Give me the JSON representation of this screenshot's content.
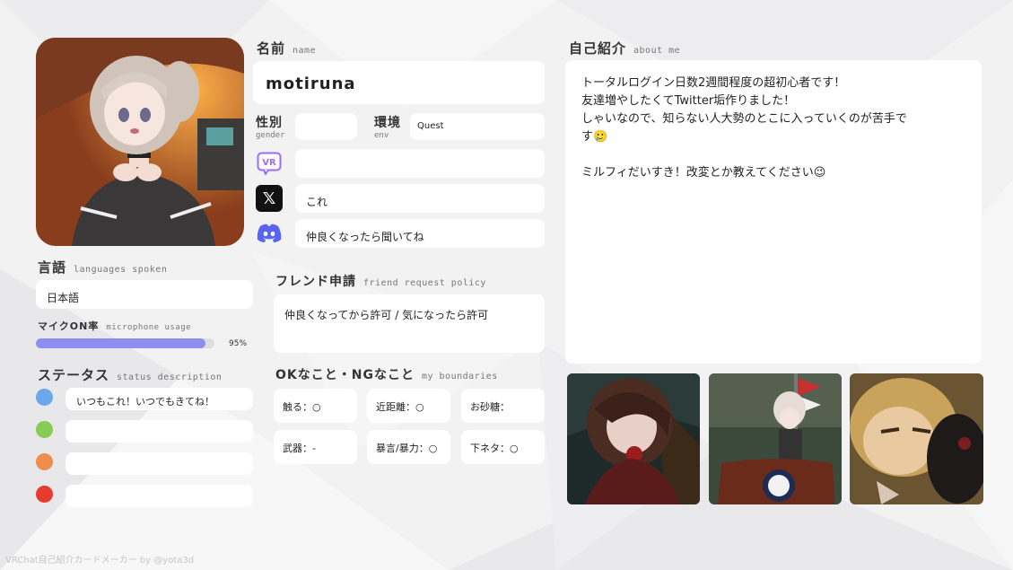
{
  "name": {
    "label": "名前",
    "sub": "name",
    "value": "motiruna"
  },
  "gender": {
    "label": "性別",
    "sub": "gender",
    "value": ""
  },
  "env": {
    "label": "環境",
    "sub": "env",
    "value": "Quest"
  },
  "vr": {
    "icon": "vr-icon",
    "icon_text": "VR",
    "value": ""
  },
  "x": {
    "icon": "x-icon",
    "icon_text": "𝕏",
    "value": "これ"
  },
  "discord": {
    "icon": "discord-icon",
    "value": "仲良くなったら聞いてね"
  },
  "languages": {
    "label": "言語",
    "sub": "languages spoken",
    "value": "日本語"
  },
  "mic": {
    "label": "マイクON率",
    "sub": "microphone usage",
    "percent": 95,
    "percent_text": "95%"
  },
  "status": {
    "label": "ステータス",
    "sub": "status description",
    "items": [
      {
        "color": "#6aa8ea",
        "text": "いつもこれ！いつでもきてね！"
      },
      {
        "color": "#86cc55",
        "text": ""
      },
      {
        "color": "#ef8e4c",
        "text": ""
      },
      {
        "color": "#e53c2f",
        "text": ""
      }
    ]
  },
  "friend": {
    "label": "フレンド申請",
    "sub": "friend request policy",
    "value": "仲良くなってから許可 / 気になったら許可"
  },
  "boundaries": {
    "label": "OKなこと・NGなこと",
    "sub": "my boundaries",
    "items": [
      "触る：○",
      "近距離：○",
      "お砂糖：",
      "武器：-",
      "暴言/暴力：○",
      "下ネタ：○"
    ]
  },
  "about": {
    "label": "自己紹介",
    "sub": "about me",
    "lines": [
      "トータルログイン日数2週間程度の超初心者です！",
      "友達増やしたくてTwitter垢作りました！",
      "しゃいなので、知らない人大勢のとこに入っていくのが苦手で",
      "す🥲",
      "",
      "ミルフィだいすき！改変とか教えてください😉"
    ]
  },
  "footer": "VRChat自己紹介カードメーカー by @yota3d",
  "colors": {
    "mic_bar": "#8d8ef0",
    "discord": "#5865f2",
    "vr_icon": "#9b6cff"
  }
}
